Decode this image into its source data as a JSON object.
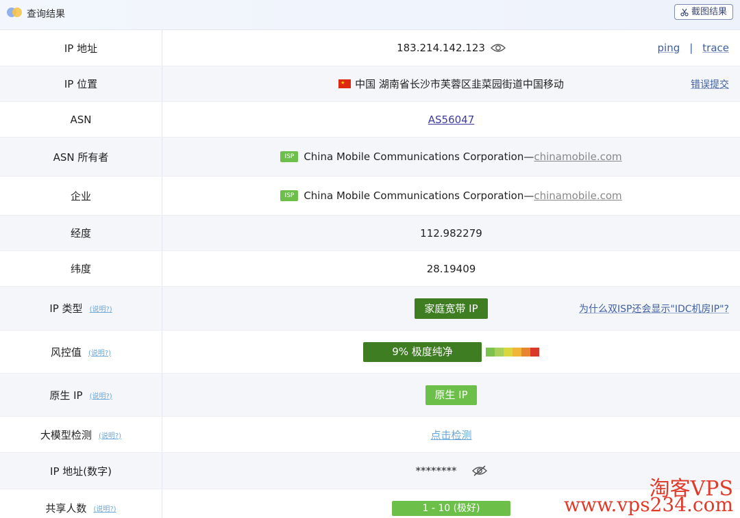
{
  "header": {
    "title": "查询结果",
    "screenshot_button": "截图结果"
  },
  "rows": {
    "ip": {
      "label": "IP 地址",
      "value": "183.214.142.123",
      "ping": "ping",
      "sep": "|",
      "trace": "trace"
    },
    "location": {
      "label": "IP 位置",
      "value": "中国 湖南省长沙市芙蓉区韭菜园街道中国移动",
      "report": "错误提交"
    },
    "asn": {
      "label": "ASN",
      "value": "AS56047"
    },
    "asn_owner": {
      "label": "ASN 所有者",
      "badge": "ISP",
      "name": "China Mobile Communications Corporation—",
      "domain": "chinamobile.com"
    },
    "company": {
      "label": "企业",
      "badge": "ISP",
      "name": "China Mobile Communications Corporation—",
      "domain": "chinamobile.com"
    },
    "longitude": {
      "label": "经度",
      "value": "112.982279"
    },
    "latitude": {
      "label": "纬度",
      "value": "28.19409"
    },
    "ip_type": {
      "label": "IP 类型",
      "help": "(说明?)",
      "value": "家庭宽带 IP",
      "question": "为什么双ISP还会显示\"IDC机房IP\"?"
    },
    "risk": {
      "label": "风控值",
      "help": "(说明?)",
      "value": "9%   极度纯净",
      "score_percent": 9,
      "scale_colors": [
        "#7cc24e",
        "#a8d05a",
        "#d9d640",
        "#f0b63a",
        "#e8852f",
        "#d9382b"
      ]
    },
    "native_ip": {
      "label": "原生 IP",
      "help": "(说明?)",
      "value": "原生 IP"
    },
    "llm_detect": {
      "label": "大模型检测",
      "help": "(说明?)",
      "value": "点击检测"
    },
    "ip_numeric": {
      "label": "IP 地址(数字)",
      "value": "********"
    },
    "shared_users": {
      "label": "共享人数",
      "help": "(说明?)",
      "value": "1 - 10 (极好)"
    }
  },
  "watermark": {
    "line1": "淘客VPS",
    "line2": "www.vps234.com"
  }
}
